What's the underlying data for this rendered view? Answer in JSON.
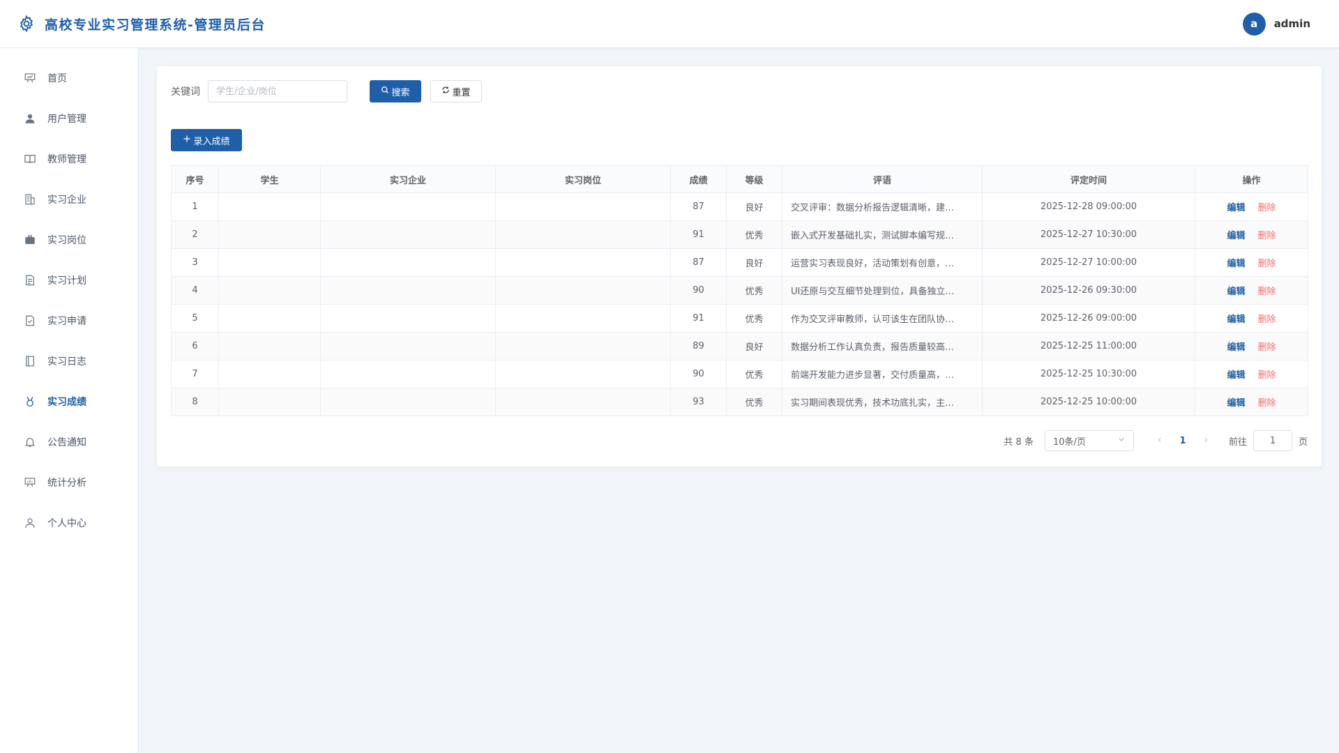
{
  "header": {
    "title": "高校专业实习管理系统-管理员后台",
    "user_initial": "a",
    "username": "admin"
  },
  "sidebar": {
    "items": [
      {
        "label": "首页",
        "icon": "presentation-icon"
      },
      {
        "label": "用户管理",
        "icon": "user-solid-icon"
      },
      {
        "label": "教师管理",
        "icon": "book-icon"
      },
      {
        "label": "实习企业",
        "icon": "building-icon"
      },
      {
        "label": "实习岗位",
        "icon": "briefcase-icon"
      },
      {
        "label": "实习计划",
        "icon": "document-icon"
      },
      {
        "label": "实习申请",
        "icon": "checklist-icon"
      },
      {
        "label": "实习日志",
        "icon": "notebook-icon"
      },
      {
        "label": "实习成绩",
        "icon": "medal-icon",
        "active": true
      },
      {
        "label": "公告通知",
        "icon": "bell-icon"
      },
      {
        "label": "统计分析",
        "icon": "chart-board-icon"
      },
      {
        "label": "个人中心",
        "icon": "user-outline-icon"
      }
    ]
  },
  "search": {
    "label": "关键词",
    "placeholder": "学生/企业/岗位",
    "value": "",
    "search_btn": "搜索",
    "reset_btn": "重置"
  },
  "toolbar": {
    "add_btn": "录入成绩"
  },
  "table": {
    "columns": [
      "序号",
      "学生",
      "实习企业",
      "实习岗位",
      "成绩",
      "等级",
      "评语",
      "评定时间",
      "操作"
    ],
    "edit_label": "编辑",
    "delete_label": "删除",
    "rows": [
      {
        "no": "1",
        "student": "",
        "company": "",
        "position": "",
        "score": "87",
        "grade": "良好",
        "comment": "交叉评审：数据分析报告逻辑清晰，建…",
        "time": "2025-12-28 09:00:00"
      },
      {
        "no": "2",
        "student": "",
        "company": "",
        "position": "",
        "score": "91",
        "grade": "优秀",
        "comment": "嵌入式开发基础扎实，测试脚本编写规…",
        "time": "2025-12-27 10:30:00"
      },
      {
        "no": "3",
        "student": "",
        "company": "",
        "position": "",
        "score": "87",
        "grade": "良好",
        "comment": "运营实习表现良好，活动策划有创意，…",
        "time": "2025-12-27 10:00:00"
      },
      {
        "no": "4",
        "student": "",
        "company": "",
        "position": "",
        "score": "90",
        "grade": "优秀",
        "comment": "UI还原与交互细节处理到位，具备独立…",
        "time": "2025-12-26 09:30:00"
      },
      {
        "no": "5",
        "student": "",
        "company": "",
        "position": "",
        "score": "91",
        "grade": "优秀",
        "comment": "作为交叉评审教师，认可该生在团队协…",
        "time": "2025-12-26 09:00:00"
      },
      {
        "no": "6",
        "student": "",
        "company": "",
        "position": "",
        "score": "89",
        "grade": "良好",
        "comment": "数据分析工作认真负责，报告质量较高…",
        "time": "2025-12-25 11:00:00"
      },
      {
        "no": "7",
        "student": "",
        "company": "",
        "position": "",
        "score": "90",
        "grade": "优秀",
        "comment": "前端开发能力进步显著，交付质量高，…",
        "time": "2025-12-25 10:30:00"
      },
      {
        "no": "8",
        "student": "",
        "company": "",
        "position": "",
        "score": "93",
        "grade": "优秀",
        "comment": "实习期间表现优秀，技术功底扎实，主…",
        "time": "2025-12-25 10:00:00"
      }
    ]
  },
  "pagination": {
    "total": "共 8 条",
    "page_size": "10条/页",
    "current": "1",
    "goto_label": "前往",
    "goto_value": "1",
    "unit": "页"
  },
  "colors": {
    "accent": "#1f5faa",
    "danger": "#f56c6c",
    "background": "#f2f5f9"
  }
}
